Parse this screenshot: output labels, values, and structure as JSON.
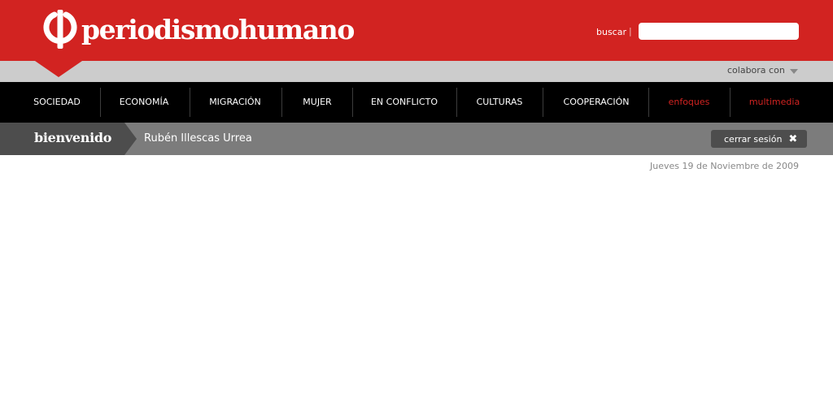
{
  "header": {
    "site_name": "periodismohumano",
    "logo_icon": "logo-mark-icon",
    "search_label": "buscar",
    "search_separator": "|",
    "search_value": "",
    "brand_color": "#d22321"
  },
  "colabora": {
    "label": "colabora con",
    "icon": "chevron-down-icon"
  },
  "nav": {
    "items": [
      {
        "label": "SOCIEDAD"
      },
      {
        "label": "ECONOMÍA"
      },
      {
        "label": "MIGRACIÓN"
      },
      {
        "label": "MUJER"
      },
      {
        "label": "EN CONFLICTO"
      },
      {
        "label": "CULTURAS"
      },
      {
        "label": "COOPERACIÓN"
      },
      {
        "label": "enfoques"
      },
      {
        "label": "multimedia"
      }
    ]
  },
  "welcome": {
    "title": "bienvenido",
    "user_name": "Rubén Illescas Urrea",
    "logout_label": "cerrar sesión",
    "logout_icon": "close-icon"
  },
  "date": "Jueves 19 de Noviembre de 2009"
}
